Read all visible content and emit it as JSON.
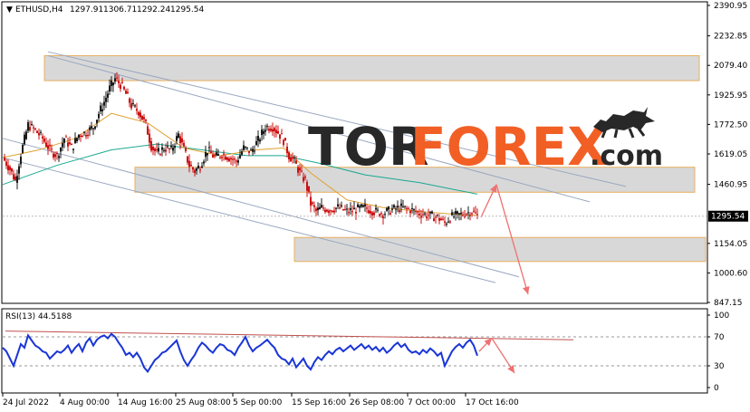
{
  "chart_data": [
    {
      "type": "candlestick",
      "header": {
        "symbol": "ETHUSD,H4",
        "open": "1297.91",
        "high": "1306.71",
        "low": "1292.24",
        "close": "1295.54"
      },
      "y_ticks": [
        "2390.95",
        "2232.85",
        "2079.40",
        "1925.95",
        "1772.50",
        "1619.05",
        "1460.95",
        "1154.05",
        "1000.60",
        "847.15"
      ],
      "ylim": [
        847.15,
        2390.95
      ],
      "current_price": "1295.54",
      "x_ticks": [
        "24 Jul 2022",
        "4 Aug 00:00",
        "14 Aug 16:00",
        "25 Aug 08:00",
        "5 Sep 00:00",
        "15 Sep 16:00",
        "26 Sep 08:00",
        "7 Oct 00:00",
        "17 Oct 16:00"
      ],
      "price_path": [
        [
          0,
          1600
        ],
        [
          8,
          1540
        ],
        [
          14,
          1480
        ],
        [
          20,
          1620
        ],
        [
          28,
          1770
        ],
        [
          36,
          1740
        ],
        [
          44,
          1700
        ],
        [
          52,
          1640
        ],
        [
          60,
          1610
        ],
        [
          68,
          1700
        ],
        [
          76,
          1650
        ],
        [
          84,
          1720
        ],
        [
          92,
          1730
        ],
        [
          100,
          1760
        ],
        [
          106,
          1830
        ],
        [
          112,
          1890
        ],
        [
          118,
          1960
        ],
        [
          124,
          2010
        ],
        [
          130,
          1980
        ],
        [
          136,
          1930
        ],
        [
          142,
          1870
        ],
        [
          150,
          1840
        ],
        [
          158,
          1770
        ],
        [
          164,
          1660
        ],
        [
          170,
          1620
        ],
        [
          178,
          1650
        ],
        [
          186,
          1640
        ],
        [
          194,
          1720
        ],
        [
          200,
          1640
        ],
        [
          206,
          1560
        ],
        [
          212,
          1530
        ],
        [
          218,
          1560
        ],
        [
          226,
          1640
        ],
        [
          234,
          1600
        ],
        [
          242,
          1620
        ],
        [
          250,
          1600
        ],
        [
          258,
          1580
        ],
        [
          266,
          1650
        ],
        [
          274,
          1630
        ],
        [
          282,
          1690
        ],
        [
          290,
          1760
        ],
        [
          298,
          1760
        ],
        [
          304,
          1730
        ],
        [
          310,
          1690
        ],
        [
          316,
          1610
        ],
        [
          322,
          1580
        ],
        [
          328,
          1520
        ],
        [
          334,
          1480
        ],
        [
          340,
          1360
        ],
        [
          346,
          1320
        ],
        [
          352,
          1340
        ],
        [
          360,
          1330
        ],
        [
          370,
          1340
        ],
        [
          380,
          1320
        ],
        [
          390,
          1330
        ],
        [
          400,
          1340
        ],
        [
          410,
          1320
        ],
        [
          420,
          1310
        ],
        [
          430,
          1330
        ],
        [
          440,
          1340
        ],
        [
          450,
          1330
        ],
        [
          460,
          1310
        ],
        [
          470,
          1300
        ],
        [
          480,
          1290
        ],
        [
          488,
          1260
        ],
        [
          494,
          1290
        ],
        [
          502,
          1300
        ],
        [
          510,
          1310
        ],
        [
          518,
          1320
        ],
        [
          524,
          1295
        ]
      ],
      "ma_fast": [
        [
          0,
          1600
        ],
        [
          40,
          1640
        ],
        [
          80,
          1700
        ],
        [
          120,
          1830
        ],
        [
          160,
          1780
        ],
        [
          200,
          1650
        ],
        [
          240,
          1610
        ],
        [
          280,
          1640
        ],
        [
          310,
          1650
        ],
        [
          340,
          1520
        ],
        [
          380,
          1380
        ],
        [
          420,
          1340
        ],
        [
          460,
          1320
        ],
        [
          500,
          1305
        ],
        [
          524,
          1300
        ]
      ],
      "ma_slow": [
        [
          0,
          1460
        ],
        [
          60,
          1560
        ],
        [
          120,
          1640
        ],
        [
          170,
          1670
        ],
        [
          220,
          1640
        ],
        [
          270,
          1610
        ],
        [
          310,
          1610
        ],
        [
          350,
          1570
        ],
        [
          400,
          1510
        ],
        [
          460,
          1470
        ],
        [
          524,
          1410
        ]
      ],
      "zones": [
        {
          "top": 2130,
          "bottom": 2000,
          "x0": 46,
          "x1": 769
        },
        {
          "top": 1550,
          "bottom": 1420,
          "x0": 146,
          "x1": 764
        },
        {
          "top": 1185,
          "bottom": 1060,
          "x0": 322,
          "x1": 776
        }
      ],
      "channel_lines": [
        [
          [
            50,
            2150
          ],
          [
            688,
            1450
          ]
        ],
        [
          [
            50,
            2130
          ],
          [
            648,
            1370
          ]
        ],
        [
          [
            0,
            1700
          ],
          [
            570,
            980
          ]
        ],
        [
          [
            0,
            1600
          ],
          [
            544,
            950
          ]
        ]
      ],
      "projection_arrows": [
        [
          [
            528,
            1290
          ],
          [
            545,
            1460
          ]
        ],
        [
          [
            545,
            1460
          ],
          [
            580,
            890
          ]
        ]
      ],
      "colors": {
        "bull": "#1a1a1a",
        "bear": "#cc1111",
        "ma_fast": "#e0a030",
        "ma_slow": "#1aa890",
        "zone_fill": "#d8d8d8",
        "zone_border": "#e8b060",
        "channel": "#9aa8c0",
        "arrow": "#f07070"
      }
    },
    {
      "type": "line",
      "title": "RSI(13) 44.5188",
      "y_ticks": [
        "100",
        "70",
        "30",
        "0"
      ],
      "ylim": [
        0,
        100
      ],
      "levels": [
        70,
        30
      ],
      "values": [
        [
          0,
          55
        ],
        [
          4,
          50
        ],
        [
          8,
          40
        ],
        [
          12,
          30
        ],
        [
          16,
          45
        ],
        [
          20,
          60
        ],
        [
          24,
          55
        ],
        [
          28,
          72
        ],
        [
          32,
          65
        ],
        [
          36,
          58
        ],
        [
          40,
          55
        ],
        [
          44,
          50
        ],
        [
          48,
          48
        ],
        [
          52,
          40
        ],
        [
          56,
          45
        ],
        [
          60,
          50
        ],
        [
          64,
          48
        ],
        [
          68,
          52
        ],
        [
          72,
          58
        ],
        [
          76,
          48
        ],
        [
          80,
          55
        ],
        [
          84,
          60
        ],
        [
          88,
          50
        ],
        [
          92,
          62
        ],
        [
          96,
          68
        ],
        [
          100,
          58
        ],
        [
          104,
          66
        ],
        [
          108,
          70
        ],
        [
          112,
          72
        ],
        [
          116,
          68
        ],
        [
          120,
          74
        ],
        [
          124,
          70
        ],
        [
          128,
          62
        ],
        [
          132,
          55
        ],
        [
          136,
          45
        ],
        [
          140,
          48
        ],
        [
          144,
          42
        ],
        [
          148,
          48
        ],
        [
          152,
          40
        ],
        [
          156,
          28
        ],
        [
          160,
          22
        ],
        [
          164,
          30
        ],
        [
          168,
          38
        ],
        [
          172,
          42
        ],
        [
          176,
          48
        ],
        [
          180,
          50
        ],
        [
          184,
          55
        ],
        [
          188,
          60
        ],
        [
          192,
          65
        ],
        [
          196,
          50
        ],
        [
          200,
          38
        ],
        [
          204,
          30
        ],
        [
          208,
          38
        ],
        [
          212,
          45
        ],
        [
          216,
          55
        ],
        [
          220,
          62
        ],
        [
          224,
          58
        ],
        [
          228,
          52
        ],
        [
          232,
          48
        ],
        [
          236,
          55
        ],
        [
          240,
          60
        ],
        [
          244,
          58
        ],
        [
          248,
          52
        ],
        [
          252,
          50
        ],
        [
          256,
          45
        ],
        [
          260,
          55
        ],
        [
          264,
          62
        ],
        [
          268,
          70
        ],
        [
          272,
          58
        ],
        [
          276,
          50
        ],
        [
          280,
          55
        ],
        [
          284,
          58
        ],
        [
          288,
          62
        ],
        [
          292,
          66
        ],
        [
          296,
          60
        ],
        [
          300,
          55
        ],
        [
          304,
          45
        ],
        [
          308,
          40
        ],
        [
          312,
          38
        ],
        [
          316,
          32
        ],
        [
          320,
          40
        ],
        [
          324,
          28
        ],
        [
          328,
          34
        ],
        [
          332,
          40
        ],
        [
          336,
          30
        ],
        [
          340,
          25
        ],
        [
          344,
          35
        ],
        [
          348,
          42
        ],
        [
          352,
          38
        ],
        [
          356,
          45
        ],
        [
          360,
          50
        ],
        [
          364,
          46
        ],
        [
          368,
          52
        ],
        [
          372,
          55
        ],
        [
          376,
          50
        ],
        [
          380,
          54
        ],
        [
          384,
          58
        ],
        [
          388,
          52
        ],
        [
          392,
          56
        ],
        [
          396,
          60
        ],
        [
          400,
          54
        ],
        [
          404,
          58
        ],
        [
          408,
          52
        ],
        [
          412,
          56
        ],
        [
          416,
          50
        ],
        [
          420,
          55
        ],
        [
          424,
          48
        ],
        [
          428,
          52
        ],
        [
          432,
          58
        ],
        [
          436,
          62
        ],
        [
          440,
          56
        ],
        [
          444,
          60
        ],
        [
          448,
          52
        ],
        [
          452,
          48
        ],
        [
          456,
          50
        ],
        [
          460,
          46
        ],
        [
          464,
          52
        ],
        [
          468,
          48
        ],
        [
          472,
          54
        ],
        [
          476,
          50
        ],
        [
          480,
          44
        ],
        [
          484,
          48
        ],
        [
          488,
          30
        ],
        [
          492,
          40
        ],
        [
          496,
          50
        ],
        [
          500,
          56
        ],
        [
          504,
          60
        ],
        [
          508,
          55
        ],
        [
          512,
          62
        ],
        [
          516,
          66
        ],
        [
          520,
          58
        ],
        [
          524,
          44
        ]
      ],
      "trend_line": [
        [
          3,
          78
        ],
        [
          630,
          66
        ]
      ],
      "projection_arrows": [
        [
          [
            526,
            50
          ],
          [
            540,
            68
          ]
        ],
        [
          [
            540,
            68
          ],
          [
            565,
            20
          ]
        ]
      ],
      "colors": {
        "line": "#1a35d8",
        "levels": "#999999",
        "trend": "#c0504d",
        "arrow": "#f07070"
      }
    }
  ],
  "logo": {
    "part1": "TOR",
    "part2": "FOREX",
    "part3": ".com"
  }
}
